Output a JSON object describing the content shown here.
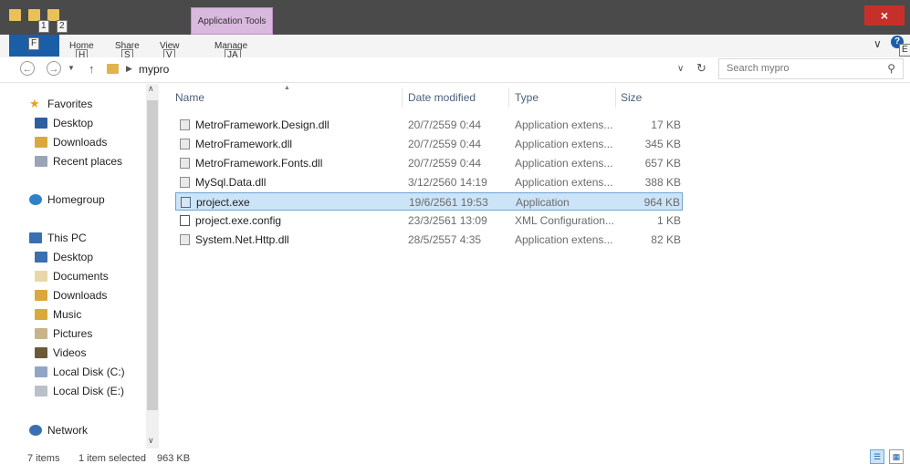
{
  "window": {
    "context_tab": "Application Tools",
    "close_glyph": "×",
    "help_glyph": "?",
    "quick_access_keytips": [
      "1",
      "2"
    ]
  },
  "ribbon": {
    "file_keytip": "F",
    "tabs": [
      {
        "label": "Home",
        "keytip": "H"
      },
      {
        "label": "Share",
        "keytip": "S"
      },
      {
        "label": "View",
        "keytip": "V"
      },
      {
        "label": "Manage",
        "keytip": "JA"
      }
    ],
    "expand_glyph": "∨",
    "help_keytip": "E"
  },
  "address": {
    "back_icon": "back-arrow-icon",
    "forward_icon": "forward-arrow-icon",
    "path": "mypro",
    "search_placeholder": "Search mypro"
  },
  "nav": {
    "favorites": {
      "label": "Favorites",
      "items": [
        "Desktop",
        "Downloads",
        "Recent places"
      ]
    },
    "homegroup": "Homegroup",
    "this_pc": {
      "label": "This PC",
      "items": [
        "Desktop",
        "Documents",
        "Downloads",
        "Music",
        "Pictures",
        "Videos",
        "Local Disk (C:)",
        "Local Disk (E:)"
      ]
    },
    "network": "Network"
  },
  "files": {
    "columns": {
      "name": "Name",
      "date": "Date modified",
      "type": "Type",
      "size": "Size"
    },
    "rows": [
      {
        "name": "MetroFramework.Design.dll",
        "date": "20/7/2559 0:44",
        "type": "Application extens...",
        "size": "17 KB",
        "icon": "dll-icon"
      },
      {
        "name": "MetroFramework.dll",
        "date": "20/7/2559 0:44",
        "type": "Application extens...",
        "size": "345 KB",
        "icon": "dll-icon"
      },
      {
        "name": "MetroFramework.Fonts.dll",
        "date": "20/7/2559 0:44",
        "type": "Application extens...",
        "size": "657 KB",
        "icon": "dll-icon"
      },
      {
        "name": "MySql.Data.dll",
        "date": "3/12/2560 14:19",
        "type": "Application extens...",
        "size": "388 KB",
        "icon": "dll-icon"
      },
      {
        "name": "project.exe",
        "date": "19/6/2561 19:53",
        "type": "Application",
        "size": "964 KB",
        "icon": "exe-icon",
        "selected": true
      },
      {
        "name": "project.exe.config",
        "date": "23/3/2561 13:09",
        "type": "XML Configuration...",
        "size": "1 KB",
        "icon": "config-icon"
      },
      {
        "name": "System.Net.Http.dll",
        "date": "28/5/2557 4:35",
        "type": "Application extens...",
        "size": "82 KB",
        "icon": "dll-icon"
      }
    ]
  },
  "status": {
    "items_count": "7 items",
    "selection": "1 item selected",
    "selection_size": "963 KB"
  },
  "colors": {
    "titlebar": "#4a4a4a",
    "file_tab": "#1a5ea8",
    "context_tab": "#d9b9de",
    "close": "#c7302a",
    "selection": "#cce4f7"
  }
}
